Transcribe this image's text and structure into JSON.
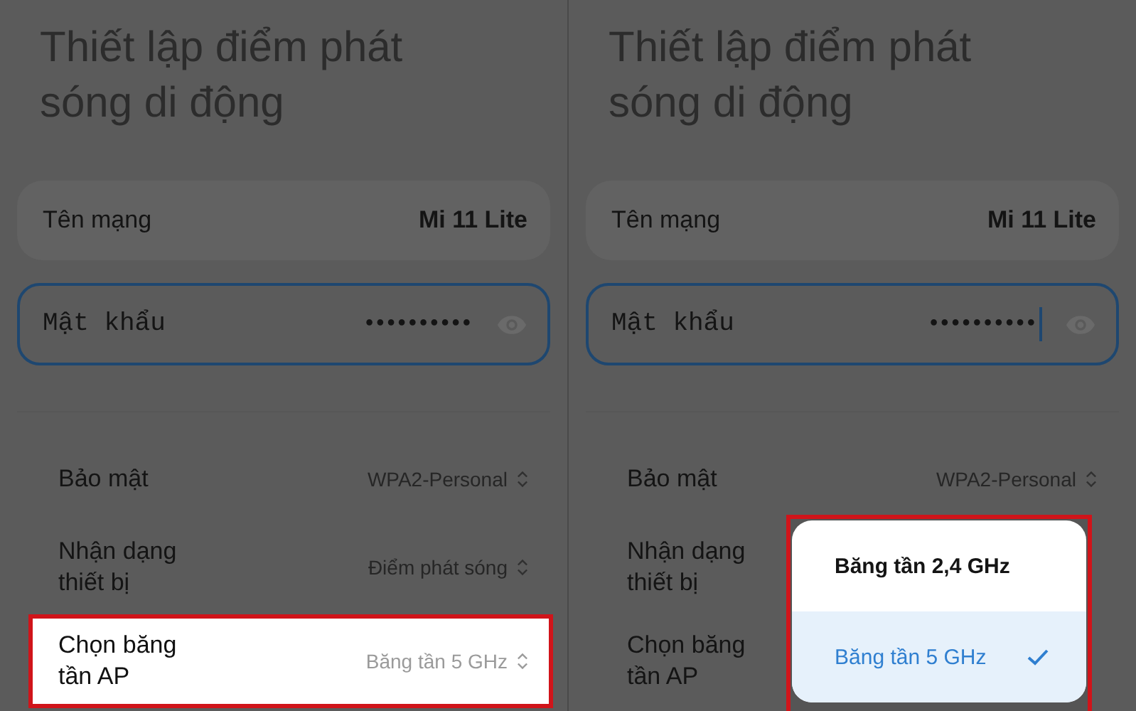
{
  "panels": [
    {
      "title": "Thiết lập điểm phát sóng di động",
      "network_name": {
        "label": "Tên mạng",
        "value": "Mi 11 Lite"
      },
      "password": {
        "label": "Mật khẩu",
        "value": "••••••••••",
        "cursor": false
      },
      "settings": [
        {
          "label": "Bảo mật",
          "value": "WPA2-Personal",
          "highlighted": false
        },
        {
          "label": "Nhận dạng thiết bị",
          "value": "Điểm phát sóng",
          "highlighted": false
        },
        {
          "label": "Chọn băng tần AP",
          "value": "Băng tần 5 GHz",
          "highlighted": true
        }
      ]
    },
    {
      "title": "Thiết lập điểm phát sóng di động",
      "network_name": {
        "label": "Tên mạng",
        "value": "Mi 11 Lite"
      },
      "password": {
        "label": "Mật khẩu",
        "value": "••••••••••",
        "cursor": true
      },
      "settings": [
        {
          "label": "Bảo mật",
          "value": "WPA2-Personal",
          "highlighted": false
        },
        {
          "label": "Nhận dạng thiết bị",
          "highlighted": false
        },
        {
          "label": "Chọn băng tần AP",
          "highlighted": false
        }
      ],
      "popup": {
        "highlighted": true,
        "options": [
          {
            "label": "Băng tần 2,4 GHz",
            "selected": false
          },
          {
            "label": "Băng tần 5 GHz",
            "selected": true
          }
        ]
      }
    }
  ]
}
